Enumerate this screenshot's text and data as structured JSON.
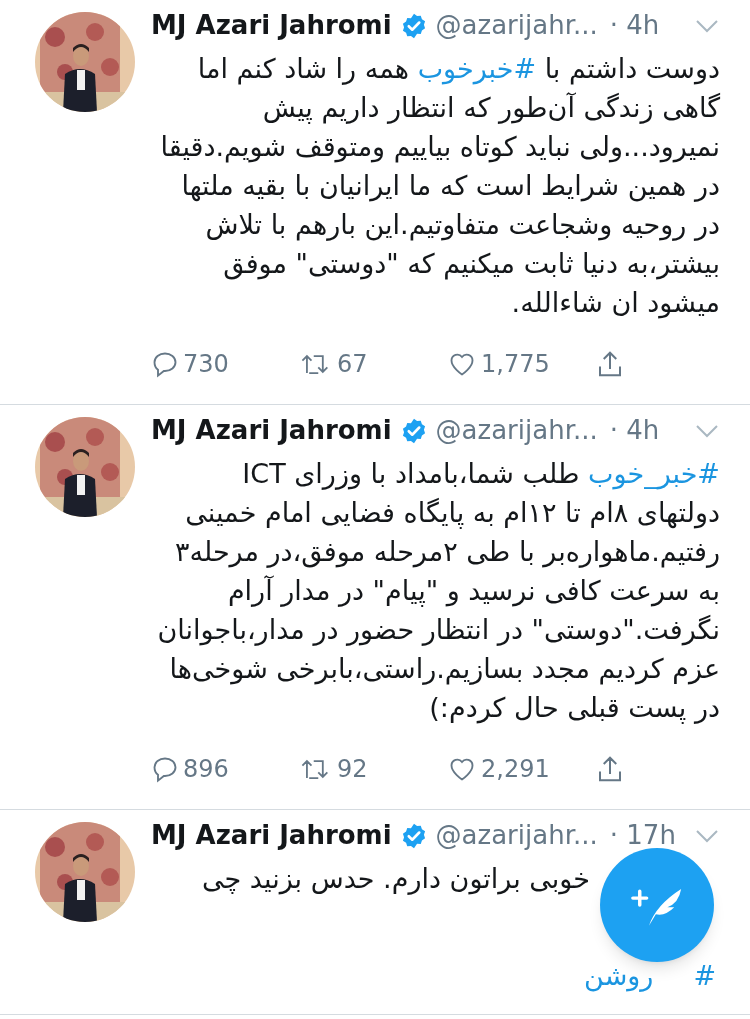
{
  "tweets": [
    {
      "name": "MJ Azari Jahromi",
      "verified": true,
      "handle": "@azarijahr...",
      "time": "· 4h",
      "body": [
        {
          "kind": "text",
          "text": "دوست داشتم با "
        },
        {
          "kind": "hashtag",
          "text": "#خبرخوب"
        },
        {
          "kind": "text",
          "text": " همه را شاد کنم اما گاهی زندگی آن‌طور که انتظار داریم پیش نمیرود...ولی نباید کوتاه بیاییم ومتوقف شویم.دقیقا در همین شرایط است که ما ایرانیان با بقیه ملتها در روحیه وشجاعت متفاوتیم.این بارهم با تلاش بیشتر،به دنیا ثابت میکنیم که \"دوستی\" موفق میشود ان شاءالله."
        }
      ],
      "replies": "730",
      "retweets": "67",
      "likes": "1,775"
    },
    {
      "name": "MJ Azari Jahromi",
      "verified": true,
      "handle": "@azarijahr...",
      "time": "· 4h",
      "body": [
        {
          "kind": "hashtag",
          "text": "#خبر_خوب"
        },
        {
          "kind": "text",
          "text": " طلب شما،بامداد با وزرای ICT دولتهای ۸ام تا ۱۲ام به پایگاه فضایی امام خمینی رفتیم.ماهواره‌بر با طی ۲مرحله موفق،در مرحله۳ به سرعت کافی نرسید و \"پیام\" در مدار آرام نگرفت.\"دوستی\" در انتظار حضور در مدار،باجوانان عزم کردیم مجدد بسازیم.راستی،بابرخی شوخی‌ها در پست قبلی حال کردم:)"
        }
      ],
      "replies": "896",
      "retweets": "92",
      "likes": "2,291"
    },
    {
      "name": "MJ Azari Jahromi",
      "verified": true,
      "handle": "@azarijahr...",
      "time": "· 17h",
      "line": "خوبی براتون دارم. حدس بزنید چی",
      "hashtag_start": "#",
      "hashtag_end": "روشن"
    }
  ]
}
